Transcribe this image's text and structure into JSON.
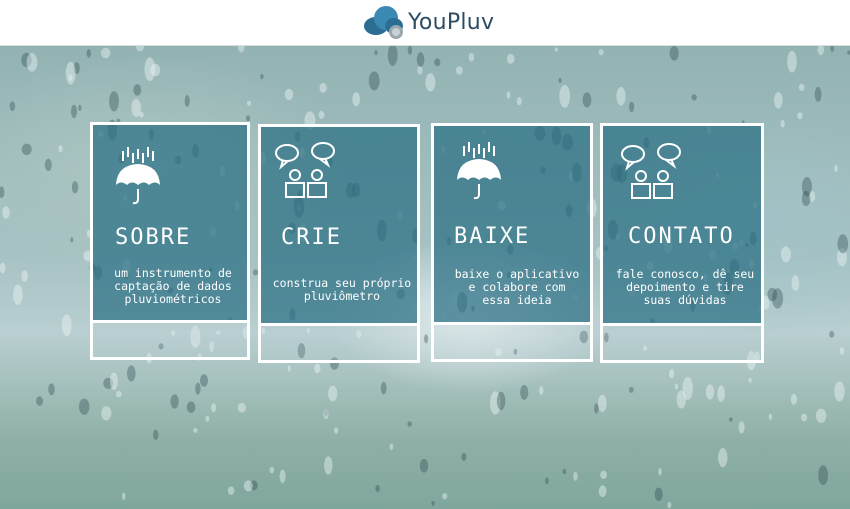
{
  "brand": {
    "name": "YouPluv"
  },
  "cards": [
    {
      "title": "SOBRE",
      "description": "um instrumento de captação de dados pluviométricos",
      "icon": "rain-umbrella-icon"
    },
    {
      "title": "CRIE",
      "description": "construa seu próprio pluviômetro",
      "icon": "chat-people-icon"
    },
    {
      "title": "BAIXE",
      "description": "baixe o aplicativo e colabore com essa ideia",
      "icon": "rain-umbrella-icon"
    },
    {
      "title": "CONTATO",
      "description": "fale conosco, dê seu depoimento e tire suas dúvidas",
      "icon": "chat-people-icon"
    }
  ],
  "colors": {
    "panel": "#2a6f83",
    "logo_text": "#2c4c62",
    "border": "#ffffff"
  }
}
